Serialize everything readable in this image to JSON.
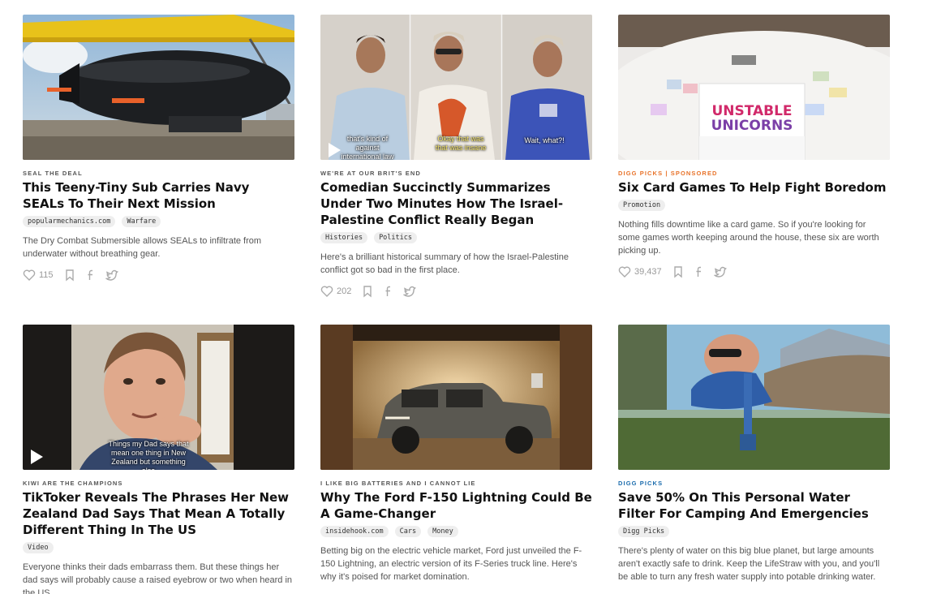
{
  "cards": [
    {
      "kicker": "SEAL THE DEAL",
      "title": "This Teeny-Tiny Sub Carries Navy SEALs To Their Next Mission",
      "tags": [
        "popularmechanics.com",
        "Warfare"
      ],
      "description": "The Dry Combat Submersible allows SEALs to infiltrate from underwater without breathing gear.",
      "likes": "115",
      "video": false
    },
    {
      "kicker": "WE'RE AT OUR BRIT'S END",
      "title": "Comedian Succinctly Summarizes Under Two Minutes How The Israel-Palestine Conflict Really Began",
      "tags": [
        "Histories",
        "Politics"
      ],
      "description": "Here's a brilliant historical summary of how the Israel-Palestine conflict got so bad in the first place.",
      "likes": "202",
      "video": true,
      "captions": [
        "that's kind of against international law",
        "Okay that was that was insane",
        "Wait, what?!"
      ]
    },
    {
      "kicker": "DIGG PICKS | SPONSORED",
      "title": "Six Card Games To Help Fight Boredom",
      "tags": [
        "Promotion"
      ],
      "description": "Nothing fills downtime like a card game. So if you're looking for some games worth keeping around the house, these six are worth picking up.",
      "likes": "39,437",
      "video": false,
      "box_text": [
        "UNSTABLE",
        "UNICORNS"
      ]
    },
    {
      "kicker": "KIWI ARE THE CHAMPIONS",
      "title": "TikToker Reveals The Phrases Her New Zealand Dad Says That Mean A Totally Different Thing In The US",
      "tags": [
        "Video"
      ],
      "description": "Everyone thinks their dads embarrass them. But these things her dad says will probably cause a raised eyebrow or two when heard in the US.",
      "likes": "",
      "video": true,
      "captions": [
        "Things my Dad says that mean one thing in New Zealand but something else"
      ]
    },
    {
      "kicker": "I LIKE BIG BATTERIES AND I CANNOT LIE",
      "title": "Why The Ford F-150 Lightning Could Be A Game-Changer",
      "tags": [
        "insidehook.com",
        "Cars",
        "Money"
      ],
      "description": "Betting big on the electric vehicle market, Ford just unveiled the F-150 Lightning, an electric version of its F-Series truck line. Here's why it's poised for market domination.",
      "likes": "",
      "video": false
    },
    {
      "kicker": "DIGG PICKS",
      "title": "Save 50% On This Personal Water Filter For Camping And Emergencies",
      "tags": [
        "Digg Picks"
      ],
      "description": "There's plenty of water on this big blue planet, but large amounts aren't exactly safe to drink. Keep the LifeStraw with you, and you'll be able to turn any fresh water supply into potable drinking water.",
      "likes": "",
      "video": false
    }
  ],
  "colors": {
    "sponsored": "#e8732a",
    "digg_picks": "#1b6cad"
  }
}
